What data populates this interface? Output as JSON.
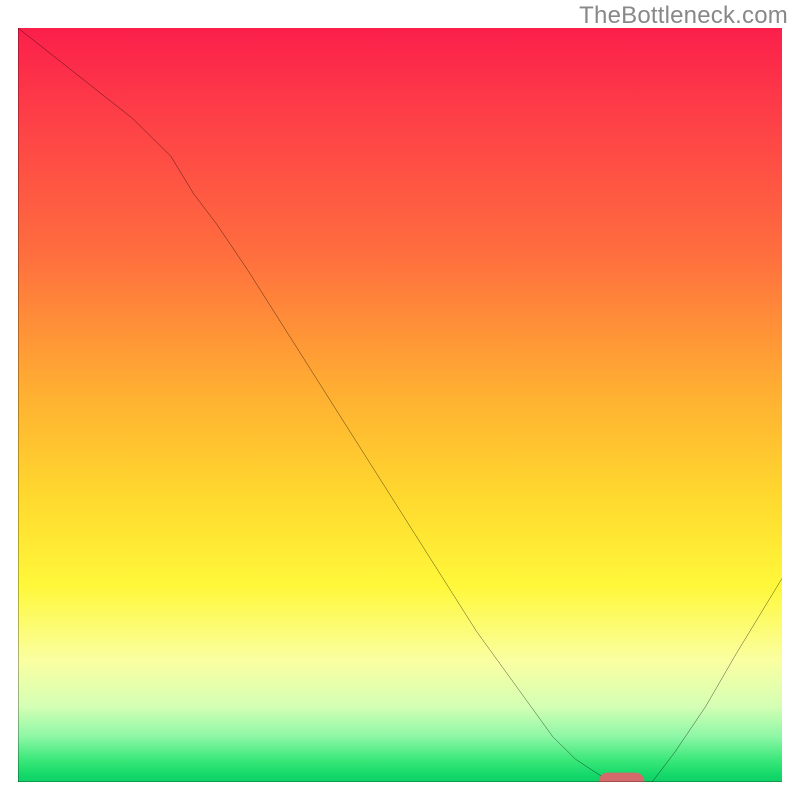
{
  "watermark": "TheBottleneck.com",
  "chart_data": {
    "type": "line",
    "title": "",
    "xlabel": "",
    "ylabel": "",
    "xlim": [
      0,
      100
    ],
    "ylim": [
      0,
      100
    ],
    "grid": false,
    "legend": false,
    "series": [
      {
        "name": "bottleneck-curve",
        "x": [
          0,
          5,
          10,
          15,
          20,
          23,
          26,
          30,
          35,
          40,
          45,
          50,
          55,
          60,
          65,
          70,
          73,
          76,
          78,
          80,
          83,
          86,
          90,
          94,
          97,
          100
        ],
        "values": [
          100,
          96,
          92,
          88,
          83,
          78,
          74,
          68,
          60,
          52,
          44,
          36,
          28,
          20,
          13,
          6,
          3,
          1,
          0,
          0,
          0,
          4,
          10,
          17,
          22,
          27
        ]
      }
    ],
    "marker": {
      "name": "optimal-point",
      "x": 79,
      "y": 0,
      "color": "#d46a6a",
      "width": 6,
      "height": 2.5
    },
    "background_gradient": {
      "stops": [
        {
          "pos": 0,
          "color": "#fb1f4a"
        },
        {
          "pos": 10,
          "color": "#fd3a48"
        },
        {
          "pos": 30,
          "color": "#ff6e3e"
        },
        {
          "pos": 48,
          "color": "#ffae32"
        },
        {
          "pos": 62,
          "color": "#ffd82e"
        },
        {
          "pos": 74,
          "color": "#fff83a"
        },
        {
          "pos": 84,
          "color": "#faffa2"
        },
        {
          "pos": 90,
          "color": "#d4ffb4"
        },
        {
          "pos": 94,
          "color": "#8cf7a6"
        },
        {
          "pos": 97,
          "color": "#3ce87a"
        },
        {
          "pos": 99,
          "color": "#15d96a"
        },
        {
          "pos": 100,
          "color": "#0fd066"
        }
      ]
    },
    "axes_color": "#000000",
    "line_color": "#000000"
  }
}
